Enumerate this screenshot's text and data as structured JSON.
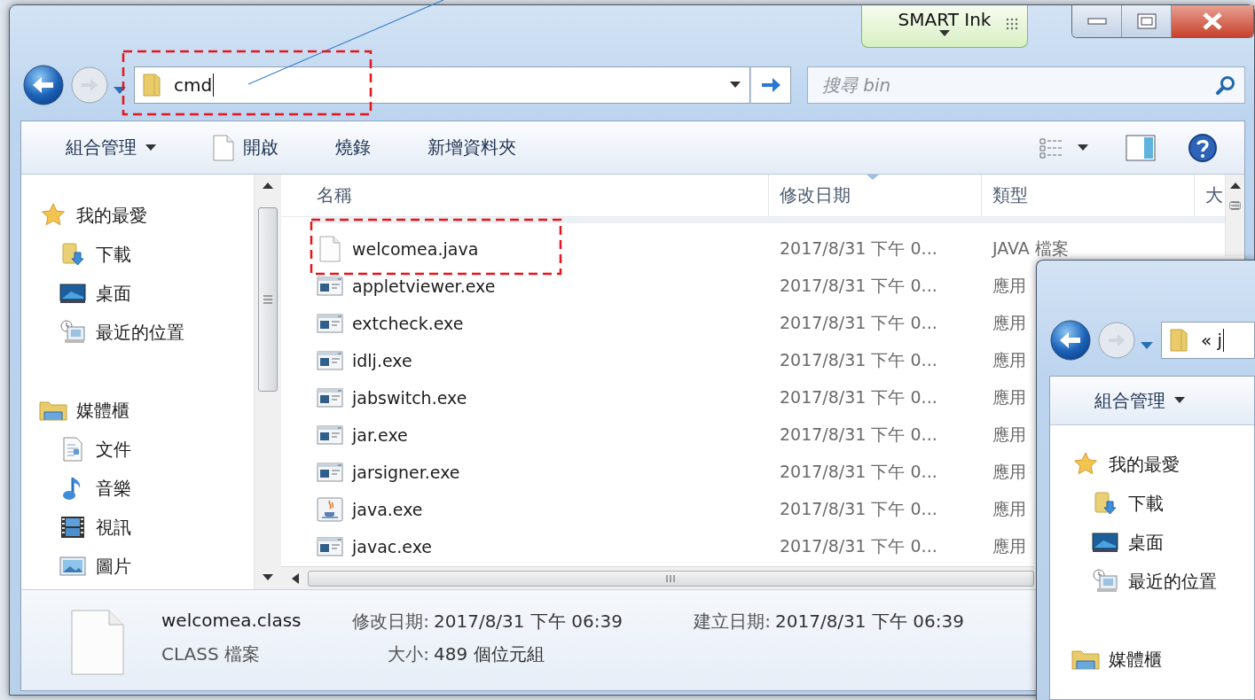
{
  "main_window": {
    "smart_ink": {
      "label": "SMART Ink"
    },
    "address_bar": {
      "value": "cmd"
    },
    "search": {
      "placeholder": "搜尋 bin"
    },
    "toolbar": [
      {
        "label": "組合管理",
        "kind": "menu"
      },
      {
        "label": "開啟",
        "kind": "open"
      },
      {
        "label": "燒錄",
        "kind": "plain"
      },
      {
        "label": "新增資料夾",
        "kind": "plain"
      }
    ],
    "nav_pane": [
      {
        "label": "我的最愛",
        "kind": "favorites",
        "children": [
          {
            "label": "下載",
            "kind": "downloads"
          },
          {
            "label": "桌面",
            "kind": "desktop"
          },
          {
            "label": "最近的位置",
            "kind": "recent"
          }
        ]
      },
      {
        "label": "媒體櫃",
        "kind": "libraries",
        "children": [
          {
            "label": "文件",
            "kind": "documents"
          },
          {
            "label": "音樂",
            "kind": "music"
          },
          {
            "label": "視訊",
            "kind": "videos"
          },
          {
            "label": "圖片",
            "kind": "pictures"
          }
        ]
      }
    ],
    "file_list": {
      "columns": [
        {
          "label": "名稱",
          "sorted": false
        },
        {
          "label": "修改日期",
          "sorted": true
        },
        {
          "label": "類型",
          "sorted": false
        },
        {
          "label": "大",
          "sorted": false
        }
      ],
      "rows": [
        {
          "name": "welcomea.java",
          "kind": "text-file",
          "modified": "2017/8/31 下午 0...",
          "type": "JAVA 檔案"
        },
        {
          "name": "appletviewer.exe",
          "kind": "app",
          "modified": "2017/8/31 下午 0...",
          "type": "應用"
        },
        {
          "name": "extcheck.exe",
          "kind": "app",
          "modified": "2017/8/31 下午 0...",
          "type": "應用"
        },
        {
          "name": "idlj.exe",
          "kind": "app",
          "modified": "2017/8/31 下午 0...",
          "type": "應用"
        },
        {
          "name": "jabswitch.exe",
          "kind": "app",
          "modified": "2017/8/31 下午 0...",
          "type": "應用"
        },
        {
          "name": "jar.exe",
          "kind": "app",
          "modified": "2017/8/31 下午 0...",
          "type": "應用"
        },
        {
          "name": "jarsigner.exe",
          "kind": "app",
          "modified": "2017/8/31 下午 0...",
          "type": "應用"
        },
        {
          "name": "java.exe",
          "kind": "java-app",
          "modified": "2017/8/31 下午 0...",
          "type": "應用"
        },
        {
          "name": "javac.exe",
          "kind": "app",
          "modified": "2017/8/31 下午 0...",
          "type": "應用"
        }
      ]
    },
    "details": {
      "name": "welcomea.class",
      "type": "CLASS 檔案",
      "modified_label": "修改日期:",
      "modified": "2017/8/31 下午 06:39",
      "created_label": "建立日期:",
      "created": "2017/8/31 下午 06:39",
      "size_label": "大小:",
      "size": "489 個位元組"
    }
  },
  "second_window": {
    "address_bar": {
      "value": "« j"
    },
    "toolbar": [
      {
        "label": "組合管理",
        "kind": "menu"
      }
    ],
    "nav_pane": [
      {
        "label": "我的最愛",
        "kind": "favorites",
        "children": [
          {
            "label": "下載",
            "kind": "downloads"
          },
          {
            "label": "桌面",
            "kind": "desktop"
          },
          {
            "label": "最近的位置",
            "kind": "recent"
          }
        ]
      },
      {
        "label": "媒體櫃",
        "kind": "libraries"
      }
    ]
  }
}
